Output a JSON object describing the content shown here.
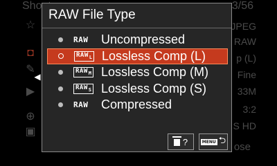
{
  "background_menu": {
    "tab_title": "Shoot",
    "page_indicator": "3/56",
    "right_values": [
      "JPEG",
      "RAW",
      "p (L)",
      "Fine",
      "33M",
      "3:2",
      "S HD"
    ],
    "side_icons": [
      "star-icon",
      "camera-icon",
      "edit-icon",
      "arrow-left-icon",
      "play-icon",
      "globe-icon",
      "toolbox-icon"
    ],
    "close_label": "ose"
  },
  "dialog": {
    "title": "RAW File Type",
    "options": [
      {
        "icon": "RAW",
        "icon_sub": "",
        "label": "Uncompressed",
        "selected": false
      },
      {
        "icon": "RAW",
        "icon_sub": "L",
        "label": "Lossless Comp (L)",
        "selected": true
      },
      {
        "icon": "RAW",
        "icon_sub": "M",
        "label": "Lossless Comp (M)",
        "selected": false
      },
      {
        "icon": "RAW",
        "icon_sub": "S",
        "label": "Lossless Comp (S)",
        "selected": false
      },
      {
        "icon": "RAW",
        "icon_sub": "",
        "label": "Compressed",
        "selected": false
      }
    ],
    "help_button": {
      "label": "?",
      "icon": "trash-icon"
    },
    "back_button": {
      "menu_tag": "MENU",
      "icon": "return-arrow-icon"
    }
  },
  "colors": {
    "selection": "#c53a1e",
    "dialog_bg": "#262626",
    "border": "#8a8a8a"
  }
}
